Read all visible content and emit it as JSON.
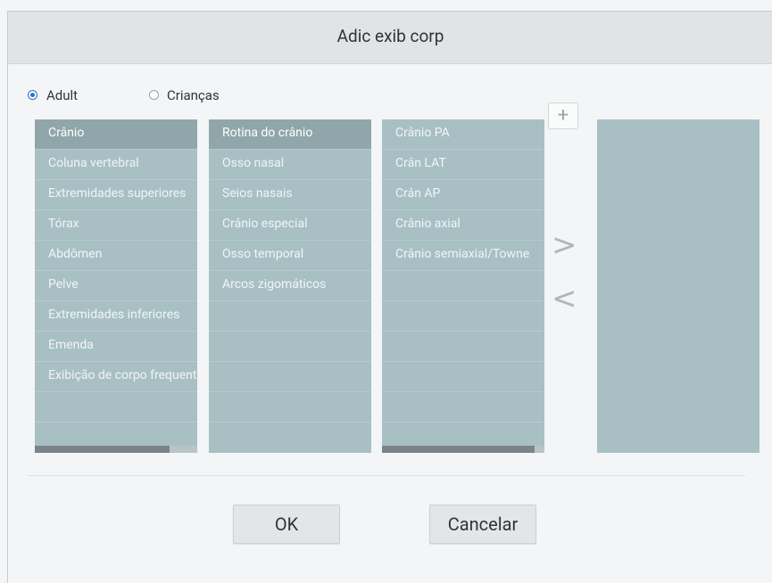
{
  "dialog": {
    "title": "Adic exib corp"
  },
  "patient_type": {
    "options": [
      {
        "label": "Adult",
        "checked": true
      },
      {
        "label": "Crianças",
        "checked": false
      }
    ]
  },
  "lists": {
    "body_part": {
      "items": [
        "Crânio",
        "Coluna vertebral",
        "Extremidades superiores",
        "Tórax",
        "Abdômen",
        "Pelve",
        "Extremidades inferiores",
        "Emenda",
        "Exibição de corpo frequente"
      ],
      "selected": 0,
      "scroll_fraction": 0.83
    },
    "exam": {
      "items": [
        "Rotina do crânio",
        "Osso nasal",
        "Seios nasais",
        "Crânio especial",
        "Osso temporal",
        "Arcos zigomáticos"
      ],
      "selected": 0
    },
    "view": {
      "items": [
        "Crânio PA",
        "Crân LAT",
        "Crân AP",
        "Crânio axial",
        "Crânio semiaxial/Towne"
      ],
      "selected": -1,
      "scroll_fraction": 0.94
    },
    "selected_views": {
      "items": []
    }
  },
  "controls": {
    "add_symbol": "+",
    "move_right_symbol": ">",
    "move_left_symbol": "<"
  },
  "buttons": {
    "ok": "OK",
    "cancel": "Cancelar"
  }
}
